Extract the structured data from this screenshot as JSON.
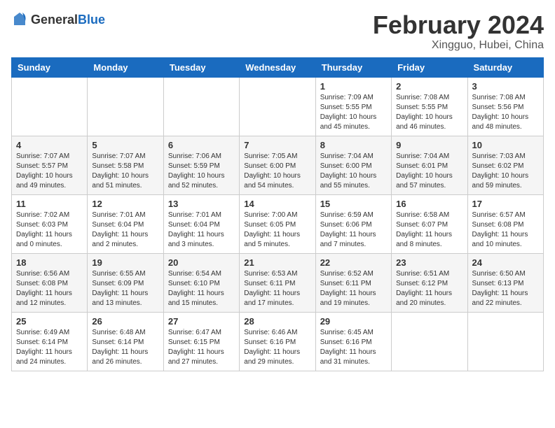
{
  "header": {
    "logo_general": "General",
    "logo_blue": "Blue",
    "title": "February 2024",
    "subtitle": "Xingguo, Hubei, China"
  },
  "calendar": {
    "days_of_week": [
      "Sunday",
      "Monday",
      "Tuesday",
      "Wednesday",
      "Thursday",
      "Friday",
      "Saturday"
    ],
    "weeks": [
      [
        {
          "day": "",
          "info": ""
        },
        {
          "day": "",
          "info": ""
        },
        {
          "day": "",
          "info": ""
        },
        {
          "day": "",
          "info": ""
        },
        {
          "day": "1",
          "info": "Sunrise: 7:09 AM\nSunset: 5:55 PM\nDaylight: 10 hours\nand 45 minutes."
        },
        {
          "day": "2",
          "info": "Sunrise: 7:08 AM\nSunset: 5:55 PM\nDaylight: 10 hours\nand 46 minutes."
        },
        {
          "day": "3",
          "info": "Sunrise: 7:08 AM\nSunset: 5:56 PM\nDaylight: 10 hours\nand 48 minutes."
        }
      ],
      [
        {
          "day": "4",
          "info": "Sunrise: 7:07 AM\nSunset: 5:57 PM\nDaylight: 10 hours\nand 49 minutes."
        },
        {
          "day": "5",
          "info": "Sunrise: 7:07 AM\nSunset: 5:58 PM\nDaylight: 10 hours\nand 51 minutes."
        },
        {
          "day": "6",
          "info": "Sunrise: 7:06 AM\nSunset: 5:59 PM\nDaylight: 10 hours\nand 52 minutes."
        },
        {
          "day": "7",
          "info": "Sunrise: 7:05 AM\nSunset: 6:00 PM\nDaylight: 10 hours\nand 54 minutes."
        },
        {
          "day": "8",
          "info": "Sunrise: 7:04 AM\nSunset: 6:00 PM\nDaylight: 10 hours\nand 55 minutes."
        },
        {
          "day": "9",
          "info": "Sunrise: 7:04 AM\nSunset: 6:01 PM\nDaylight: 10 hours\nand 57 minutes."
        },
        {
          "day": "10",
          "info": "Sunrise: 7:03 AM\nSunset: 6:02 PM\nDaylight: 10 hours\nand 59 minutes."
        }
      ],
      [
        {
          "day": "11",
          "info": "Sunrise: 7:02 AM\nSunset: 6:03 PM\nDaylight: 11 hours\nand 0 minutes."
        },
        {
          "day": "12",
          "info": "Sunrise: 7:01 AM\nSunset: 6:04 PM\nDaylight: 11 hours\nand 2 minutes."
        },
        {
          "day": "13",
          "info": "Sunrise: 7:01 AM\nSunset: 6:04 PM\nDaylight: 11 hours\nand 3 minutes."
        },
        {
          "day": "14",
          "info": "Sunrise: 7:00 AM\nSunset: 6:05 PM\nDaylight: 11 hours\nand 5 minutes."
        },
        {
          "day": "15",
          "info": "Sunrise: 6:59 AM\nSunset: 6:06 PM\nDaylight: 11 hours\nand 7 minutes."
        },
        {
          "day": "16",
          "info": "Sunrise: 6:58 AM\nSunset: 6:07 PM\nDaylight: 11 hours\nand 8 minutes."
        },
        {
          "day": "17",
          "info": "Sunrise: 6:57 AM\nSunset: 6:08 PM\nDaylight: 11 hours\nand 10 minutes."
        }
      ],
      [
        {
          "day": "18",
          "info": "Sunrise: 6:56 AM\nSunset: 6:08 PM\nDaylight: 11 hours\nand 12 minutes."
        },
        {
          "day": "19",
          "info": "Sunrise: 6:55 AM\nSunset: 6:09 PM\nDaylight: 11 hours\nand 13 minutes."
        },
        {
          "day": "20",
          "info": "Sunrise: 6:54 AM\nSunset: 6:10 PM\nDaylight: 11 hours\nand 15 minutes."
        },
        {
          "day": "21",
          "info": "Sunrise: 6:53 AM\nSunset: 6:11 PM\nDaylight: 11 hours\nand 17 minutes."
        },
        {
          "day": "22",
          "info": "Sunrise: 6:52 AM\nSunset: 6:11 PM\nDaylight: 11 hours\nand 19 minutes."
        },
        {
          "day": "23",
          "info": "Sunrise: 6:51 AM\nSunset: 6:12 PM\nDaylight: 11 hours\nand 20 minutes."
        },
        {
          "day": "24",
          "info": "Sunrise: 6:50 AM\nSunset: 6:13 PM\nDaylight: 11 hours\nand 22 minutes."
        }
      ],
      [
        {
          "day": "25",
          "info": "Sunrise: 6:49 AM\nSunset: 6:14 PM\nDaylight: 11 hours\nand 24 minutes."
        },
        {
          "day": "26",
          "info": "Sunrise: 6:48 AM\nSunset: 6:14 PM\nDaylight: 11 hours\nand 26 minutes."
        },
        {
          "day": "27",
          "info": "Sunrise: 6:47 AM\nSunset: 6:15 PM\nDaylight: 11 hours\nand 27 minutes."
        },
        {
          "day": "28",
          "info": "Sunrise: 6:46 AM\nSunset: 6:16 PM\nDaylight: 11 hours\nand 29 minutes."
        },
        {
          "day": "29",
          "info": "Sunrise: 6:45 AM\nSunset: 6:16 PM\nDaylight: 11 hours\nand 31 minutes."
        },
        {
          "day": "",
          "info": ""
        },
        {
          "day": "",
          "info": ""
        }
      ]
    ]
  }
}
